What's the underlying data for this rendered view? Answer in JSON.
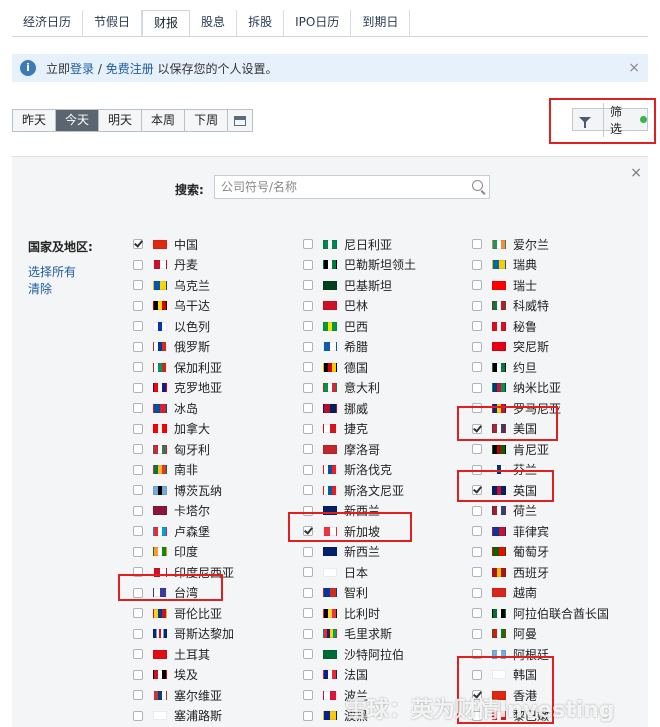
{
  "tabs": [
    "经济日历",
    "节假日",
    "财报",
    "股息",
    "拆股",
    "IPO日历",
    "到期日"
  ],
  "active_tab": 2,
  "notice": {
    "prefix": "立即",
    "login": "登录",
    "sep": " / ",
    "register": "免费注册",
    "suffix": " 以保存您的个人设置。",
    "close": "×"
  },
  "days": [
    "昨天",
    "今天",
    "明天",
    "本周",
    "下周"
  ],
  "active_day": 1,
  "filter": {
    "label": "筛选",
    "status_color": "#3bb34a"
  },
  "panel": {
    "close": "×",
    "search_label": "搜索:",
    "search_placeholder": "公司符号/名称",
    "region_title": "国家及地区:",
    "select_all": "选择所有",
    "clear": "清除"
  },
  "countries": [
    [
      {
        "name": "中国",
        "checked": true,
        "flag": [
          "#de2910"
        ]
      },
      {
        "name": "丹麦",
        "checked": false,
        "flag": [
          "#c8102e",
          "#ffffff"
        ]
      },
      {
        "name": "乌克兰",
        "checked": false,
        "flag": [
          "#0057b7",
          "#ffd700"
        ]
      },
      {
        "name": "乌干达",
        "checked": false,
        "flag": [
          "#000000",
          "#fcdc04",
          "#d90000"
        ]
      },
      {
        "name": "以色列",
        "checked": false,
        "flag": [
          "#ffffff",
          "#0038b8",
          "#ffffff"
        ]
      },
      {
        "name": "俄罗斯",
        "checked": false,
        "flag": [
          "#ffffff",
          "#0039a6",
          "#d52b1e"
        ]
      },
      {
        "name": "保加利亚",
        "checked": false,
        "flag": [
          "#ffffff",
          "#00966e",
          "#d62612"
        ]
      },
      {
        "name": "克罗地亚",
        "checked": false,
        "flag": [
          "#ff0000",
          "#ffffff",
          "#171796"
        ]
      },
      {
        "name": "冰岛",
        "checked": false,
        "flag": [
          "#02529c",
          "#dc1e35"
        ]
      },
      {
        "name": "加拿大",
        "checked": false,
        "flag": [
          "#ff0000",
          "#ffffff",
          "#ff0000"
        ]
      },
      {
        "name": "匈牙利",
        "checked": false,
        "flag": [
          "#ce2939",
          "#ffffff",
          "#477050"
        ]
      },
      {
        "name": "南非",
        "checked": false,
        "flag": [
          "#007749",
          "#ffb81c",
          "#de3831"
        ]
      },
      {
        "name": "博茨瓦纳",
        "checked": false,
        "flag": [
          "#75aadb",
          "#000000",
          "#75aadb"
        ]
      },
      {
        "name": "卡塔尔",
        "checked": false,
        "flag": [
          "#8a1538"
        ]
      },
      {
        "name": "卢森堡",
        "checked": false,
        "flag": [
          "#ed2939",
          "#ffffff",
          "#00a1de"
        ]
      },
      {
        "name": "印度",
        "checked": false,
        "flag": [
          "#ff9933",
          "#ffffff",
          "#138808"
        ]
      },
      {
        "name": "印度尼西亚",
        "checked": false,
        "flag": [
          "#ce1126",
          "#ffffff"
        ]
      },
      {
        "name": "台湾",
        "checked": false,
        "flag": [
          "#ffffff",
          "#3a3aa0"
        ]
      },
      {
        "name": "哥伦比亚",
        "checked": false,
        "flag": [
          "#fcd116",
          "#003893",
          "#ce1126"
        ]
      },
      {
        "name": "哥斯达黎加",
        "checked": false,
        "flag": [
          "#002b7f",
          "#ffffff",
          "#ce1126",
          "#ffffff",
          "#002b7f"
        ]
      },
      {
        "name": "土耳其",
        "checked": false,
        "flag": [
          "#e30a17"
        ]
      },
      {
        "name": "埃及",
        "checked": false,
        "flag": [
          "#ce1126",
          "#ffffff",
          "#000000"
        ]
      },
      {
        "name": "塞尔维亚",
        "checked": false,
        "flag": [
          "#c6363c",
          "#0c4076",
          "#ffffff"
        ]
      },
      {
        "name": "塞浦路斯",
        "checked": false,
        "flag": [
          "#ffffff"
        ]
      }
    ],
    [
      {
        "name": "尼日利亚",
        "checked": false,
        "flag": [
          "#008751",
          "#ffffff",
          "#008751"
        ]
      },
      {
        "name": "巴勒斯坦领土",
        "checked": false,
        "flag": [
          "#000000",
          "#ffffff",
          "#007a3d"
        ]
      },
      {
        "name": "巴基斯坦",
        "checked": false,
        "flag": [
          "#01411c"
        ]
      },
      {
        "name": "巴林",
        "checked": false,
        "flag": [
          "#ce1126"
        ]
      },
      {
        "name": "巴西",
        "checked": false,
        "flag": [
          "#009c3b",
          "#ffdf00",
          "#009c3b"
        ]
      },
      {
        "name": "希腊",
        "checked": false,
        "flag": [
          "#0d5eaf",
          "#ffffff"
        ]
      },
      {
        "name": "德国",
        "checked": false,
        "flag": [
          "#000000",
          "#dd0000",
          "#ffce00"
        ]
      },
      {
        "name": "意大利",
        "checked": false,
        "flag": [
          "#009246",
          "#ffffff",
          "#ce2b37"
        ]
      },
      {
        "name": "挪威",
        "checked": false,
        "flag": [
          "#ba0c2f",
          "#00205b"
        ]
      },
      {
        "name": "捷克",
        "checked": false,
        "flag": [
          "#ffffff",
          "#d7141a"
        ]
      },
      {
        "name": "摩洛哥",
        "checked": false,
        "flag": [
          "#c1272d"
        ]
      },
      {
        "name": "斯洛伐克",
        "checked": false,
        "flag": [
          "#ffffff",
          "#0b4ea2",
          "#ee1c25"
        ]
      },
      {
        "name": "斯洛文尼亚",
        "checked": false,
        "flag": [
          "#ffffff",
          "#005da4",
          "#ed1c24"
        ]
      },
      {
        "name": "新西兰",
        "checked": false,
        "flag": [
          "#012169"
        ]
      },
      {
        "name": "新加坡",
        "checked": true,
        "flag": [
          "#ef3340",
          "#ffffff"
        ]
      },
      {
        "name": "新西兰",
        "checked": false,
        "flag": [
          "#012169"
        ]
      },
      {
        "name": "日本",
        "checked": false,
        "flag": [
          "#ffffff"
        ]
      },
      {
        "name": "智利",
        "checked": false,
        "flag": [
          "#0039a6",
          "#d52b1e"
        ]
      },
      {
        "name": "比利时",
        "checked": false,
        "flag": [
          "#000000",
          "#fdda24",
          "#ef3340"
        ]
      },
      {
        "name": "毛里求斯",
        "checked": false,
        "flag": [
          "#ea2839",
          "#1a206d",
          "#ffd500",
          "#00a551"
        ]
      },
      {
        "name": "沙特阿拉伯",
        "checked": false,
        "flag": [
          "#006c35"
        ]
      },
      {
        "name": "法国",
        "checked": false,
        "flag": [
          "#002395",
          "#ffffff",
          "#ed2939"
        ]
      },
      {
        "name": "波兰",
        "checked": false,
        "flag": [
          "#ffffff",
          "#dc143c"
        ]
      },
      {
        "name": "波黑",
        "checked": false,
        "flag": [
          "#002395",
          "#fecb00"
        ]
      }
    ],
    [
      {
        "name": "爱尔兰",
        "checked": false,
        "flag": [
          "#169b62",
          "#ffffff",
          "#ff883e"
        ]
      },
      {
        "name": "瑞典",
        "checked": false,
        "flag": [
          "#006aa7",
          "#fecc00"
        ]
      },
      {
        "name": "瑞士",
        "checked": false,
        "flag": [
          "#ff0000"
        ]
      },
      {
        "name": "科威特",
        "checked": false,
        "flag": [
          "#007a3d",
          "#ffffff",
          "#ce1126"
        ]
      },
      {
        "name": "秘鲁",
        "checked": false,
        "flag": [
          "#d91023",
          "#ffffff",
          "#d91023"
        ]
      },
      {
        "name": "突尼斯",
        "checked": false,
        "flag": [
          "#e70013"
        ]
      },
      {
        "name": "约旦",
        "checked": false,
        "flag": [
          "#000000",
          "#ffffff",
          "#007a3d"
        ]
      },
      {
        "name": "纳米比亚",
        "checked": false,
        "flag": [
          "#003580",
          "#d21034",
          "#009543"
        ]
      },
      {
        "name": "罗马尼亚",
        "checked": false,
        "flag": [
          "#002b7f",
          "#fcd116",
          "#ce1126"
        ]
      },
      {
        "name": "美国",
        "checked": true,
        "flag": [
          "#b22234",
          "#ffffff",
          "#3c3b6e"
        ]
      },
      {
        "name": "肯尼亚",
        "checked": false,
        "flag": [
          "#000000",
          "#bb0000",
          "#006600"
        ]
      },
      {
        "name": "芬兰",
        "checked": false,
        "flag": [
          "#ffffff",
          "#003580",
          "#ffffff"
        ]
      },
      {
        "name": "英国",
        "checked": true,
        "flag": [
          "#012169",
          "#c8102e",
          "#012169"
        ]
      },
      {
        "name": "荷兰",
        "checked": false,
        "flag": [
          "#ae1c28",
          "#ffffff",
          "#21468b"
        ]
      },
      {
        "name": "菲律宾",
        "checked": false,
        "flag": [
          "#0038a8",
          "#ce1126"
        ]
      },
      {
        "name": "葡萄牙",
        "checked": false,
        "flag": [
          "#006600",
          "#ff0000"
        ]
      },
      {
        "name": "西班牙",
        "checked": false,
        "flag": [
          "#aa151b",
          "#f1bf00",
          "#aa151b"
        ]
      },
      {
        "name": "越南",
        "checked": false,
        "flag": [
          "#da251d"
        ]
      },
      {
        "name": "阿拉伯联合酋长国",
        "checked": false,
        "flag": [
          "#00732f",
          "#ffffff",
          "#000000"
        ]
      },
      {
        "name": "阿曼",
        "checked": false,
        "flag": [
          "#db161b",
          "#ffffff",
          "#008000"
        ]
      },
      {
        "name": "阿根廷",
        "checked": false,
        "flag": [
          "#74acdf",
          "#ffffff",
          "#74acdf"
        ]
      },
      {
        "name": "韩国",
        "checked": false,
        "flag": [
          "#ffffff"
        ]
      },
      {
        "name": "香港",
        "checked": true,
        "flag": [
          "#de2910"
        ]
      },
      {
        "name": "黎巴嫩",
        "checked": false,
        "flag": [
          "#ee161f",
          "#ffffff",
          "#ee161f"
        ]
      }
    ]
  ],
  "watermark": "雪球：英为财情Investing"
}
